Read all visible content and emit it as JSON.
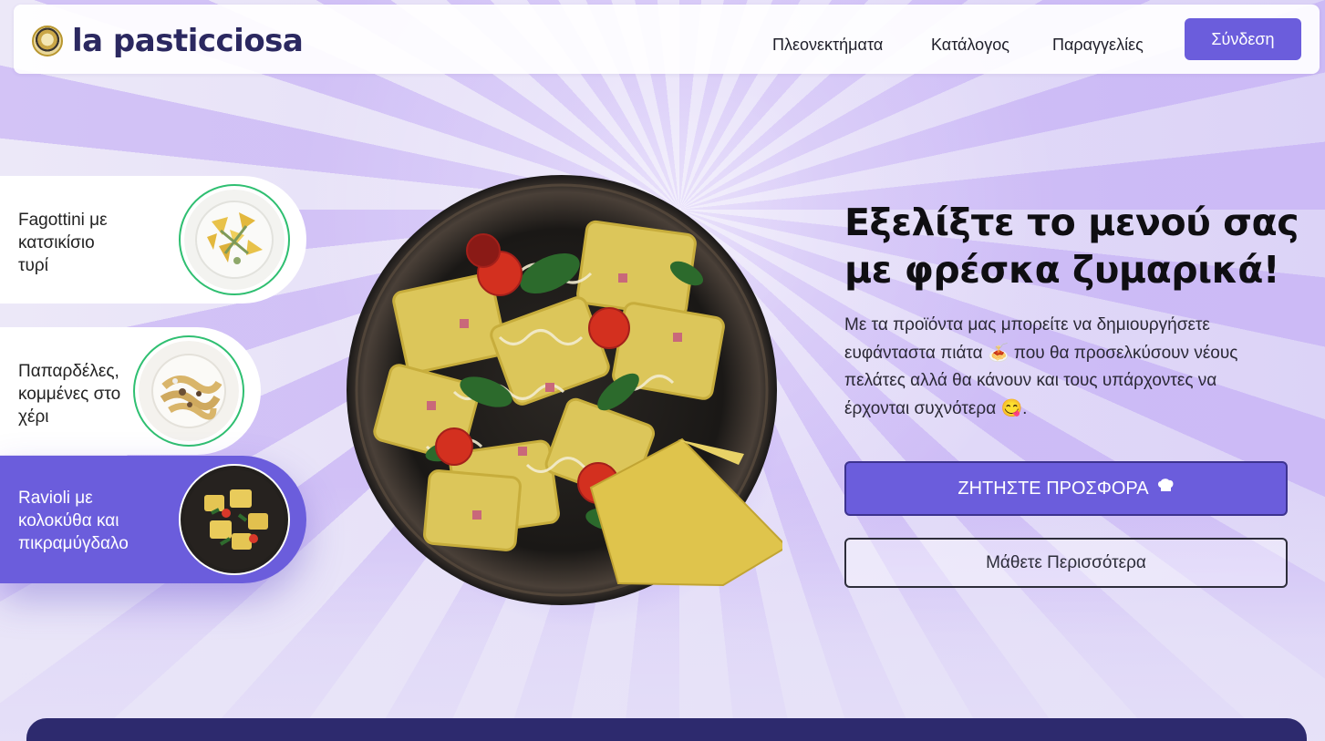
{
  "brand": {
    "name": "la pasticciosa"
  },
  "nav": {
    "links": [
      "Πλεονεκτήματα",
      "Κατάλογος",
      "Παραγγελίες"
    ],
    "login_label": "Σύνδεση"
  },
  "products": [
    {
      "label_lines": [
        "Fagottini με",
        "κατσικίσιο",
        "τυρί"
      ],
      "active": false
    },
    {
      "label_lines": [
        "Παπαρδέλες,",
        "κομμένες στο",
        "χέρι"
      ],
      "active": false
    },
    {
      "label_lines": [
        "Ravioli με",
        "κολοκύθα και",
        "πικραμύγδαλο"
      ],
      "active": true
    }
  ],
  "hero": {
    "title_line1": "Εξελίξτε το μενού σας",
    "title_line2": "με φρέσκα ζυμαρικά!",
    "desc_part1": "Με τα προϊόντα μας μπορείτε να δημιουργήσετε ευφάνταστα πιάτα",
    "desc_part2": "που θα προσελκύσουν νέους πελάτες αλλά θα κάνουν και τους υπάρχοντες να έρχονται συχνότερα",
    "desc_end": ".",
    "primary_cta": "ΖΗΤΗΣΤΕ ΠΡΟΣΦΟΡΑ",
    "secondary_cta": "Μάθετε Περισσότερα"
  },
  "icons": {
    "logo": "pasta-seal-logo-icon",
    "pasta_plate_emoji": "🍝",
    "yum_emoji": "😋",
    "chef_hat": "chef-hat-icon"
  },
  "colors": {
    "accent": "#6b5ddc",
    "accent_dark": "#3d338f",
    "brand_text": "#2b2860",
    "thumb_ring": "#2fbf71",
    "footer_band": "#2d2a6e"
  }
}
